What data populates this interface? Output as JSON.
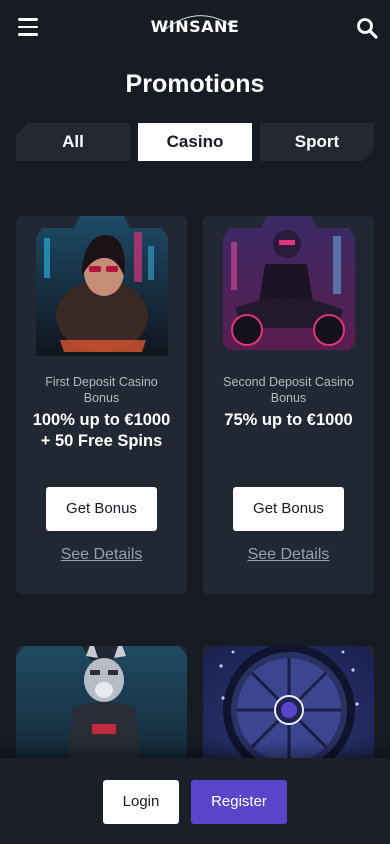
{
  "header": {
    "logo_text": "WINSANE",
    "menu_icon": "hamburger-menu-icon",
    "search_icon": "search-icon"
  },
  "page": {
    "title": "Promotions"
  },
  "tabs": [
    {
      "label": "All",
      "active": false
    },
    {
      "label": "Casino",
      "active": true
    },
    {
      "label": "Sport",
      "active": false
    }
  ],
  "promotions": [
    {
      "subtitle": "First Deposit Casino Bonus",
      "headline": "100% up to €1000 + 50 Free Spins",
      "button_label": "Get Bonus",
      "details_label": "See Details"
    },
    {
      "subtitle": "Second Deposit Casino Bonus",
      "headline": "75% up to €1000",
      "button_label": "Get Bonus",
      "details_label": "See Details"
    }
  ],
  "footer": {
    "login_label": "Login",
    "register_label": "Register"
  },
  "colors": {
    "background": "#171b23",
    "card": "#222833",
    "accent": "#5a44c9"
  }
}
